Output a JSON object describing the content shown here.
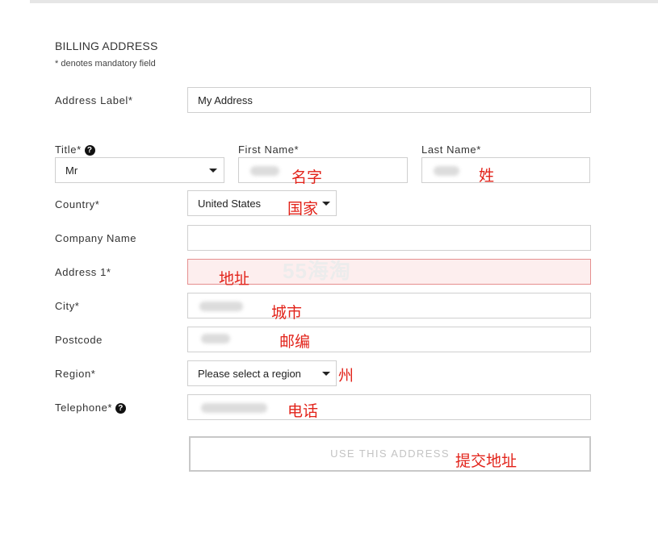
{
  "form": {
    "title": "BILLING ADDRESS",
    "mandatory_note": "* denotes mandatory field",
    "address_label": {
      "label": "Address Label*",
      "value": "My Address"
    },
    "title_field": {
      "label": "Title*",
      "value": "Mr"
    },
    "first_name": {
      "label": "First Name*"
    },
    "last_name": {
      "label": "Last Name*"
    },
    "country": {
      "label": "Country*",
      "value": "United States"
    },
    "company": {
      "label": "Company Name"
    },
    "address1": {
      "label": "Address 1*"
    },
    "city": {
      "label": "City*"
    },
    "postcode": {
      "label": "Postcode"
    },
    "region": {
      "label": "Region*",
      "value": "Please select a region"
    },
    "telephone": {
      "label": "Telephone*"
    },
    "submit_label": "USE THIS ADDRESS"
  },
  "annotations": {
    "first_name": "名字",
    "last_name": "姓",
    "country": "国家",
    "address": "地址",
    "city": "城市",
    "postcode": "邮编",
    "region": "州",
    "phone": "电话",
    "submit": "提交地址"
  },
  "watermark": "55海淘",
  "icons": {
    "help": "question-circle-icon",
    "dropdown": "caret-down-icon"
  },
  "colors": {
    "annotation": "#e2231a",
    "error_bg": "#fdeeee",
    "error_border": "#e58f8f"
  }
}
